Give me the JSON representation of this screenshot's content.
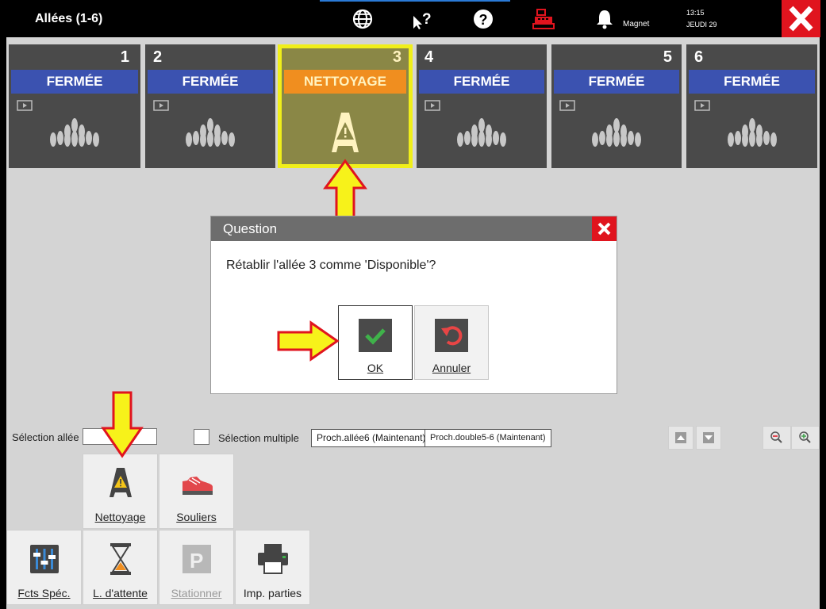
{
  "header": {
    "title": "Allées (1-6)",
    "user": "Magnet",
    "time": "13:15",
    "day": "JEUDI 29"
  },
  "lanes": [
    {
      "number": "1",
      "status": "FERMÉE"
    },
    {
      "number": "2",
      "status": "FERMÉE"
    },
    {
      "number": "3",
      "status": "NETTOYAGE"
    },
    {
      "number": "4",
      "status": "FERMÉE"
    },
    {
      "number": "5",
      "status": "FERMÉE"
    },
    {
      "number": "6",
      "status": "FERMÉE"
    }
  ],
  "dialog": {
    "title": "Question",
    "message": "Rétablir l'allée 3 comme 'Disponible'?",
    "ok_label": "OK",
    "cancel_label": "Annuler"
  },
  "selection": {
    "lane_label": "Sélection allée",
    "lane_value": "",
    "multiple_label": "Sélection multiple",
    "next_lane": "Proch.allée6 (Maintenant)",
    "next_double": "Proch.double5-6 (Maintenant)"
  },
  "tools": {
    "cleaning": "Nettoyage",
    "shoes": "Souliers",
    "special": "Fcts Spéc.",
    "waitlist": "L. d'attente",
    "parking": "Stationner",
    "print": "Imp. parties"
  },
  "colors": {
    "closed_status": "#3b52b0",
    "cleaning_status": "#f08e1f",
    "highlight": "#f0ef1a",
    "close_red": "#e0141e"
  }
}
